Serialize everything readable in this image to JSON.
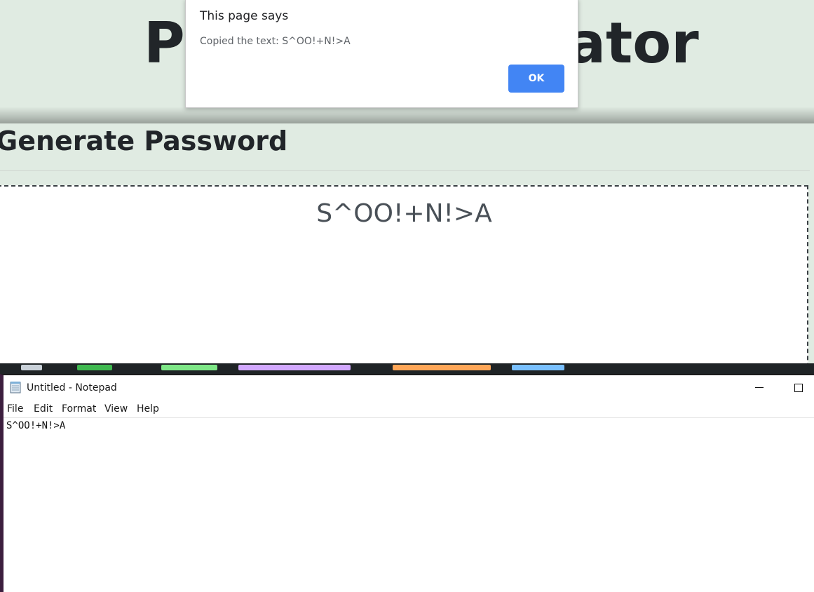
{
  "browser": {
    "site_title_left": "Pa",
    "site_title_right": "ator",
    "card_header": "Generate Password",
    "password": "S^OO!+N!>A"
  },
  "alert": {
    "title": "This page says",
    "message": "Copied the text: S^OO!+N!>A",
    "ok_label": "OK"
  },
  "notepad": {
    "title": "Untitled - Notepad",
    "menu": [
      "File",
      "Edit",
      "Format",
      "View",
      "Help"
    ],
    "content": "S^OO!+N!>A",
    "icons": {
      "app": "notepad-icon",
      "minimize": "minimize-icon",
      "maximize": "maximize-icon"
    }
  },
  "colors": {
    "page_background": "#e0ebe2",
    "alert_ok_button": "#4285f4",
    "title_text": "#212529"
  }
}
